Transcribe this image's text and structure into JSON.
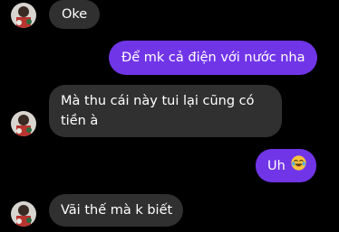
{
  "conversation": {
    "messages": [
      {
        "from": "them",
        "text": "Oke",
        "show_avatar": true
      },
      {
        "from": "me",
        "text": "Để mk cả điện với nước nha"
      },
      {
        "from": "them",
        "lines": [
          "Mà thu cái này tui lại cũng có",
          "tiền à"
        ],
        "show_avatar": true
      },
      {
        "from": "me",
        "text": "Uh",
        "emoji": "laughing-tears-emoji"
      },
      {
        "from": "them",
        "text": "Vãi thế mà k biết",
        "show_avatar": true
      }
    ]
  },
  "colors": {
    "background": "#000000",
    "incoming_bubble": "#303030",
    "outgoing_bubble": "#7135e8",
    "text": "#ffffff",
    "emoji_face": "#f7c33b"
  }
}
